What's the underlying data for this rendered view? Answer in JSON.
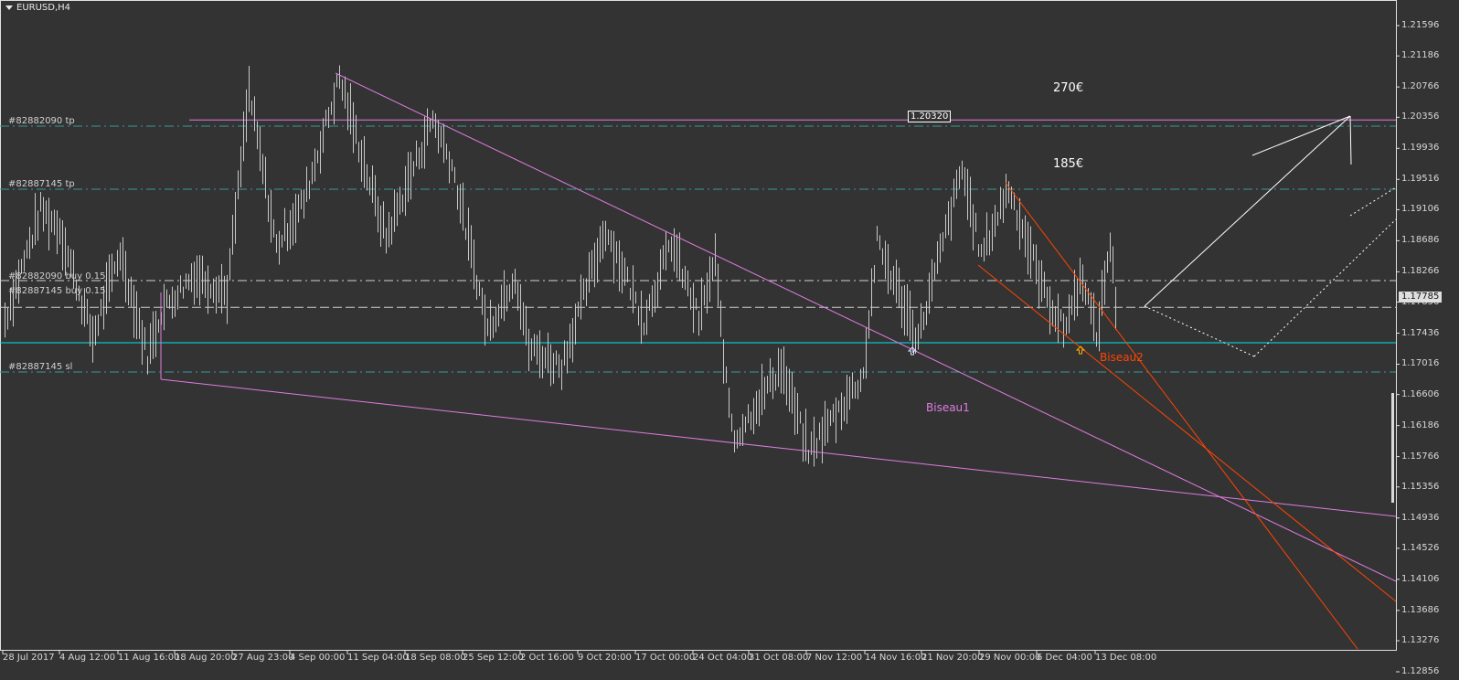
{
  "title": "EURUSD,H4",
  "current_price": "1.17785",
  "price_box": "1.20320",
  "profit_labels": [
    "270€",
    "185€"
  ],
  "wedge_labels": {
    "biseau1": "Biseau1",
    "biseau2": "Biseau2"
  },
  "order_labels": {
    "tp1": "#82882090 tp",
    "tp2": "#82887145 tp",
    "buy1": "#82882090 buy 0.15",
    "buy2": "#82887145 buy 0.15",
    "sl": "#82887145 sl"
  },
  "colors": {
    "background": "#333333",
    "bars": "#c8c8c8",
    "wedge1": "#e07ce0",
    "wedge2": "#ff4500",
    "support": "#00e5e5",
    "order_lines": "#3a9a9a"
  },
  "chart_data": {
    "type": "ohlc",
    "symbol": "EURUSD",
    "timeframe": "H4",
    "ylim": [
      1.12856,
      1.21596
    ],
    "y_ticks": [
      "1.21596",
      "1.21186",
      "1.20766",
      "1.20356",
      "1.19936",
      "1.19516",
      "1.19106",
      "1.18686",
      "1.18266",
      "1.17856",
      "1.17436",
      "1.17016",
      "1.16606",
      "1.16186",
      "1.15766",
      "1.15356",
      "1.14936",
      "1.14526",
      "1.14106",
      "1.13686",
      "1.13276",
      "1.12856"
    ],
    "x_ticks": [
      "28 Jul 2017",
      "4 Aug 12:00",
      "11 Aug 16:00",
      "18 Aug 20:00",
      "27 Aug 23:00",
      "4 Sep 00:00",
      "11 Sep 04:00",
      "18 Sep 08:00",
      "25 Sep 12:00",
      "2 Oct 16:00",
      "9 Oct 20:00",
      "17 Oct 00:00",
      "24 Oct 04:00",
      "31 Oct 08:00",
      "7 Nov 12:00",
      "14 Nov 16:00",
      "21 Nov 20:00",
      "29 Nov 00:00",
      "6 Dec 04:00",
      "13 Dec 08:00"
    ],
    "price_path": [
      [
        0,
        1.17615
      ],
      [
        13,
        1.19099
      ],
      [
        20,
        1.18852
      ],
      [
        32,
        1.17368
      ],
      [
        42,
        1.18543
      ],
      [
        52,
        1.17121
      ],
      [
        57,
        1.17739
      ],
      [
        69,
        1.18233
      ],
      [
        81,
        1.17986
      ],
      [
        89,
        1.20706
      ],
      [
        99,
        1.18604
      ],
      [
        109,
        1.19222
      ],
      [
        122,
        1.20891
      ],
      [
        133,
        1.1947
      ],
      [
        139,
        1.18728
      ],
      [
        156,
        1.20335
      ],
      [
        163,
        1.19717
      ],
      [
        176,
        1.17492
      ],
      [
        186,
        1.18233
      ],
      [
        191,
        1.17244
      ],
      [
        203,
        1.16997
      ],
      [
        219,
        1.18852
      ],
      [
        233,
        1.17615
      ],
      [
        243,
        1.18666
      ],
      [
        253,
        1.17615
      ],
      [
        259,
        1.18419
      ],
      [
        263,
        1.1675
      ],
      [
        266,
        1.16008
      ],
      [
        283,
        1.16997
      ],
      [
        293,
        1.15823
      ],
      [
        313,
        1.16874
      ],
      [
        318,
        1.18666
      ],
      [
        333,
        1.17368
      ],
      [
        349,
        1.19655
      ],
      [
        356,
        1.18481
      ],
      [
        366,
        1.19408
      ],
      [
        379,
        1.17986
      ],
      [
        386,
        1.17492
      ],
      [
        393,
        1.18233
      ],
      [
        398,
        1.17368
      ],
      [
        403,
        1.18666
      ],
      [
        405,
        1.17863
      ]
    ],
    "levels": {
      "resistance": 1.2032,
      "support": 1.17306,
      "tp1": 1.20236,
      "tp2": 1.19383,
      "buy1": 1.18147,
      "buy2": 1.17785,
      "sl": 1.16911
    }
  }
}
